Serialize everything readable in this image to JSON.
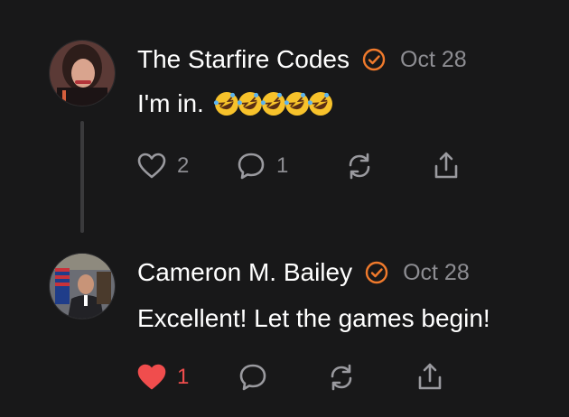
{
  "posts": [
    {
      "author": "The Starfire Codes",
      "date": "Oct 28",
      "text": "I'm in.",
      "emojis": [
        "rolling-on-floor-laughing",
        "rolling-on-floor-laughing",
        "rolling-on-floor-laughing",
        "rolling-on-floor-laughing",
        "rolling-on-floor-laughing"
      ],
      "likes": "2",
      "replies": "1",
      "liked": false
    },
    {
      "author": "Cameron M. Bailey",
      "date": "Oct 28",
      "text": "Excellent! Let the games begin!",
      "likes": "1",
      "liked": true
    }
  ],
  "colors": {
    "background": "#181819",
    "verified": "#f07a2c",
    "liked": "#f04d4d",
    "muted": "#8d8d92"
  }
}
